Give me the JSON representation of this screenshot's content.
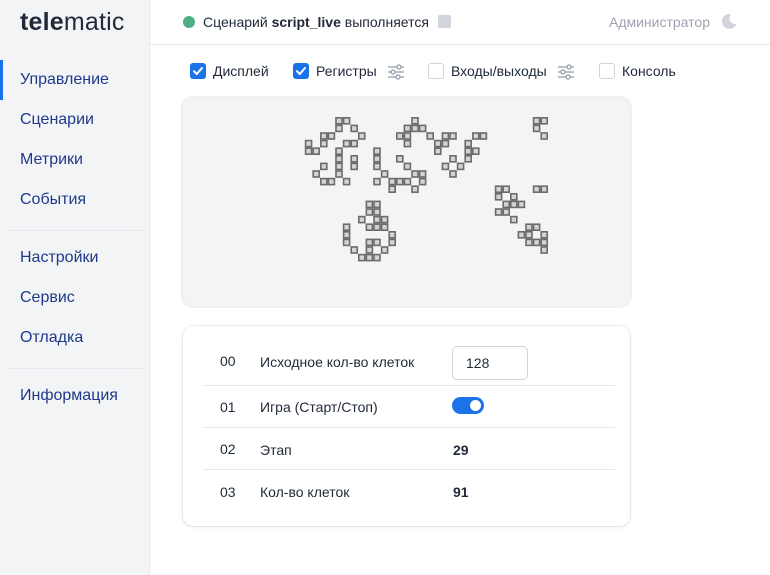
{
  "app": {
    "logo_bold": "tele",
    "logo_light": "matic"
  },
  "header": {
    "status_prefix": "Сценарий",
    "script_name": "script_live",
    "status_suffix": "выполняется",
    "user": "Администратор",
    "colors": {
      "status": "#4caf83",
      "accent": "#1a73e8"
    }
  },
  "sidebar": {
    "items": [
      {
        "label": "Управление",
        "active": true
      },
      {
        "label": "Сценарии"
      },
      {
        "label": "Метрики"
      },
      {
        "label": "События"
      },
      {
        "label": "Настройки"
      },
      {
        "label": "Сервис"
      },
      {
        "label": "Отладка"
      },
      {
        "label": "Информация"
      }
    ]
  },
  "toolbar": {
    "checkboxes": [
      {
        "label": "Дисплей",
        "checked": true
      },
      {
        "label": "Регистры",
        "checked": true
      },
      {
        "label": "Входы/выходы",
        "checked": false
      },
      {
        "label": "Консоль",
        "checked": false
      }
    ]
  },
  "display": {
    "grid_cols": 64,
    "grid_rows": 30,
    "live_cells": [
      [
        12,
        0
      ],
      [
        13,
        0
      ],
      [
        22,
        0
      ],
      [
        38,
        0
      ],
      [
        39,
        0
      ],
      [
        12,
        1
      ],
      [
        14,
        1
      ],
      [
        21,
        1
      ],
      [
        22,
        1
      ],
      [
        23,
        1
      ],
      [
        38,
        1
      ],
      [
        10,
        2
      ],
      [
        11,
        2
      ],
      [
        15,
        2
      ],
      [
        20,
        2
      ],
      [
        21,
        2
      ],
      [
        24,
        2
      ],
      [
        26,
        2
      ],
      [
        27,
        2
      ],
      [
        30,
        2
      ],
      [
        31,
        2
      ],
      [
        39,
        2
      ],
      [
        8,
        3
      ],
      [
        10,
        3
      ],
      [
        13,
        3
      ],
      [
        14,
        3
      ],
      [
        21,
        3
      ],
      [
        25,
        3
      ],
      [
        26,
        3
      ],
      [
        29,
        3
      ],
      [
        8,
        4
      ],
      [
        9,
        4
      ],
      [
        12,
        4
      ],
      [
        17,
        4
      ],
      [
        25,
        4
      ],
      [
        29,
        4
      ],
      [
        30,
        4
      ],
      [
        12,
        5
      ],
      [
        14,
        5
      ],
      [
        17,
        5
      ],
      [
        20,
        5
      ],
      [
        27,
        5
      ],
      [
        29,
        5
      ],
      [
        10,
        6
      ],
      [
        12,
        6
      ],
      [
        14,
        6
      ],
      [
        17,
        6
      ],
      [
        21,
        6
      ],
      [
        26,
        6
      ],
      [
        28,
        6
      ],
      [
        9,
        7
      ],
      [
        12,
        7
      ],
      [
        18,
        7
      ],
      [
        22,
        7
      ],
      [
        23,
        7
      ],
      [
        27,
        7
      ],
      [
        10,
        8
      ],
      [
        11,
        8
      ],
      [
        13,
        8
      ],
      [
        17,
        8
      ],
      [
        19,
        8
      ],
      [
        20,
        8
      ],
      [
        21,
        8
      ],
      [
        23,
        8
      ],
      [
        19,
        9
      ],
      [
        22,
        9
      ],
      [
        33,
        9
      ],
      [
        34,
        9
      ],
      [
        38,
        9
      ],
      [
        39,
        9
      ],
      [
        33,
        10
      ],
      [
        35,
        10
      ],
      [
        16,
        11
      ],
      [
        17,
        11
      ],
      [
        34,
        11
      ],
      [
        35,
        11
      ],
      [
        36,
        11
      ],
      [
        16,
        12
      ],
      [
        17,
        12
      ],
      [
        33,
        12
      ],
      [
        34,
        12
      ],
      [
        15,
        13
      ],
      [
        17,
        13
      ],
      [
        18,
        13
      ],
      [
        35,
        13
      ],
      [
        13,
        14
      ],
      [
        16,
        14
      ],
      [
        17,
        14
      ],
      [
        18,
        14
      ],
      [
        37,
        14
      ],
      [
        38,
        14
      ],
      [
        13,
        15
      ],
      [
        19,
        15
      ],
      [
        36,
        15
      ],
      [
        37,
        15
      ],
      [
        39,
        15
      ],
      [
        13,
        16
      ],
      [
        16,
        16
      ],
      [
        17,
        16
      ],
      [
        19,
        16
      ],
      [
        37,
        16
      ],
      [
        38,
        16
      ],
      [
        39,
        16
      ],
      [
        14,
        17
      ],
      [
        16,
        17
      ],
      [
        18,
        17
      ],
      [
        39,
        17
      ],
      [
        15,
        18
      ],
      [
        16,
        18
      ],
      [
        17,
        18
      ]
    ],
    "colors": {
      "cell": "#6b6b6b",
      "background": "#f3f4f6"
    }
  },
  "registers": [
    {
      "num": "00",
      "name": "Исходное кол-во клеток",
      "type": "input",
      "value": "128"
    },
    {
      "num": "01",
      "name": "Игра (Старт/Стоп)",
      "type": "toggle",
      "on": true
    },
    {
      "num": "02",
      "name": "Этап",
      "type": "value",
      "value": "29"
    },
    {
      "num": "03",
      "name": "Кол-во клеток",
      "type": "value",
      "value": "91"
    }
  ]
}
